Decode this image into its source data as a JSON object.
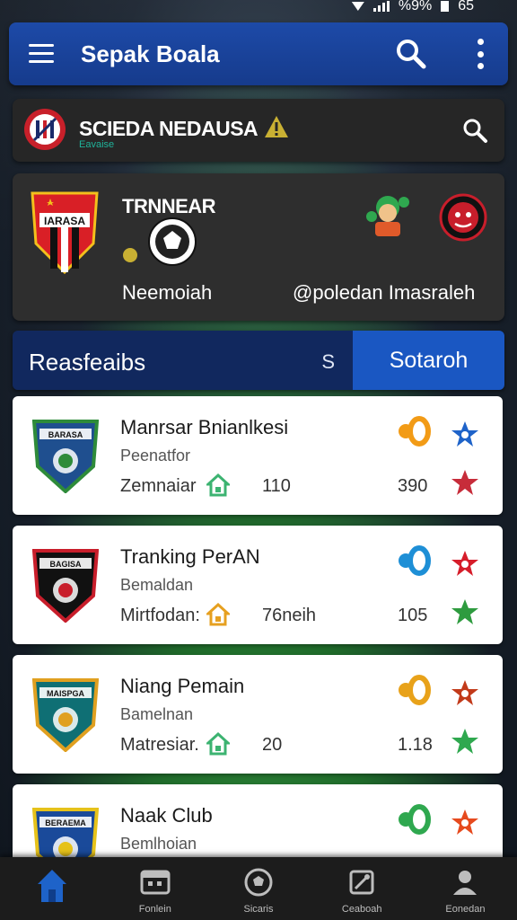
{
  "statusbar": {
    "battery": "%9%",
    "time": "65"
  },
  "appbar": {
    "title": "Sepak Boala"
  },
  "league": {
    "name": "SCIEDA NEDAUSA",
    "subtitle": "Eavaise"
  },
  "match": {
    "tag": "TRNNEAR",
    "home_name": "Neemoiah",
    "away_name": "@poledan Imasraleh",
    "home_crest_text": "IARASA"
  },
  "tabs": {
    "left_label": "Reasfeaibs",
    "left_icon": "S",
    "right_label": "Sotaroh"
  },
  "cards": [
    {
      "title": "Manrsar Bnianlkesi",
      "sub": "Peenatfor",
      "meta": "Zemnaiar",
      "num1": "110",
      "num2": "390",
      "crest_text": "BARASA",
      "colors": {
        "crest": "#1f4f8f",
        "crest_trim": "#2e8b3a",
        "score": "#f29b16",
        "act1": "#1e63c9",
        "act2": "#c72c3a",
        "metaicon": "#3cb371"
      }
    },
    {
      "title": "Tranking PerAN",
      "sub": "Bemaldan",
      "meta": "Mirtfodan:",
      "num1": "76neih",
      "num2": "105",
      "crest_text": "BAGISA",
      "colors": {
        "crest": "#111111",
        "crest_trim": "#c81e2b",
        "score": "#1e8fd6",
        "act1": "#d61d2a",
        "act2": "#2e9b3f",
        "metaicon": "#e6a020"
      }
    },
    {
      "title": "Niang Pemain",
      "sub": "Bamelnan",
      "meta": "Matresiar.",
      "num1": "20",
      "num2": "1.18",
      "crest_text": "MAISPGA",
      "colors": {
        "crest": "#0f6f74",
        "crest_trim": "#e0a020",
        "score": "#e8a21a",
        "act1": "#c23a1a",
        "act2": "#2fa84f",
        "metaicon": "#3cb371"
      }
    },
    {
      "title": "Naak Club",
      "sub": "Bemlhoian",
      "meta": "",
      "num1": "",
      "num2": "",
      "crest_text": "BERAEMA",
      "colors": {
        "crest": "#1a4a9a",
        "crest_trim": "#e6c21a",
        "score": "#2fa84f",
        "act1": "#e64a1e",
        "act2": "#e8a21a",
        "metaicon": "#3cb371"
      }
    }
  ],
  "bottomnav": [
    {
      "label": "",
      "icon": "home-icon"
    },
    {
      "label": "Fonlein",
      "icon": "calendar-icon"
    },
    {
      "label": "Sicaris",
      "icon": "ball-icon"
    },
    {
      "label": "Ceaboah",
      "icon": "trophy-icon"
    },
    {
      "label": "Eonedan",
      "icon": "profile-icon"
    }
  ],
  "colors": {
    "appbar": "#1d4aa8",
    "tab_active": "#1a57c2",
    "tab_inactive": "#11285e",
    "nav_active": "#1e63c9"
  }
}
